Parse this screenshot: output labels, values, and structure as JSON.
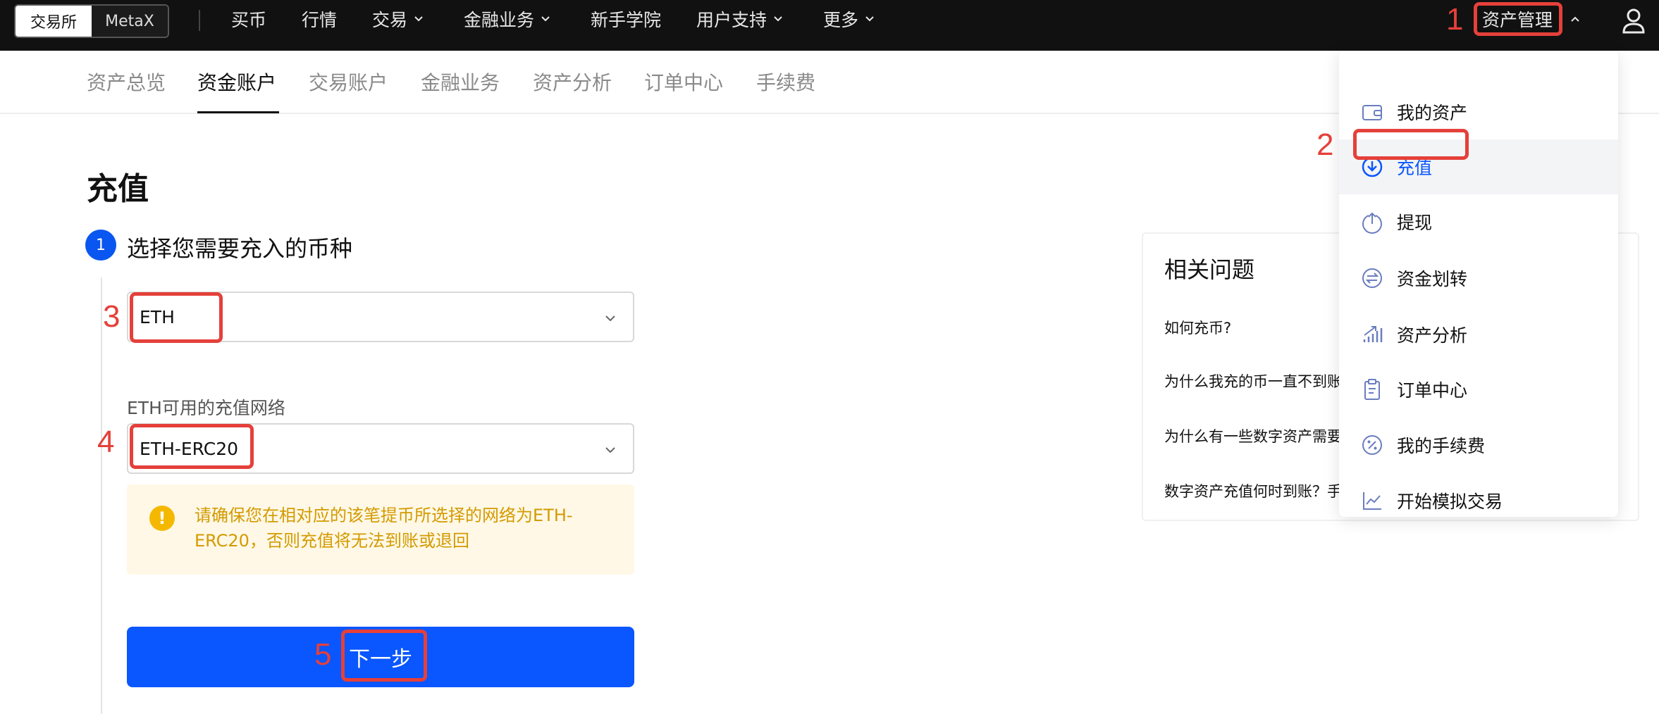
{
  "top_nav": {
    "segments": [
      "交易所",
      "MetaX"
    ],
    "items": [
      {
        "label": "买币",
        "has_chevron": false
      },
      {
        "label": "行情",
        "has_chevron": false
      },
      {
        "label": "交易",
        "has_chevron": true
      },
      {
        "label": "金融业务",
        "has_chevron": true
      },
      {
        "label": "新手学院",
        "has_chevron": false
      },
      {
        "label": "用户支持",
        "has_chevron": true
      },
      {
        "label": "更多",
        "has_chevron": true
      }
    ],
    "asset_management": "资产管理"
  },
  "sub_nav": {
    "items": [
      "资产总览",
      "资金账户",
      "交易账户",
      "金融业务",
      "资产分析",
      "订单中心",
      "手续费"
    ],
    "active": "资金账户"
  },
  "main": {
    "title": "充值",
    "step_number": "1",
    "step_title": "选择您需要充入的币种",
    "coin_value": "ETH",
    "network_label": "ETH可用的充值网络",
    "network_value": "ETH-ERC20",
    "warning_icon_glyph": "!",
    "warning_text": "请确保您在相对应的该笔提币所选择的网络为ETH-ERC20，否则充值将无法到账或退回",
    "next_button": "下一步"
  },
  "faq": {
    "title": "相关问题",
    "items": [
      "如何充币?",
      "为什么我充的币一直不到账",
      "为什么有一些数字资产需要",
      "数字资产充值何时到账？手"
    ]
  },
  "dropdown": {
    "items": [
      {
        "label": "我的资产",
        "icon": "wallet-icon"
      },
      {
        "label": "充值",
        "icon": "deposit-icon"
      },
      {
        "label": "提现",
        "icon": "withdraw-icon"
      },
      {
        "label": "资金划转",
        "icon": "transfer-icon"
      },
      {
        "label": "资产分析",
        "icon": "analysis-icon"
      },
      {
        "label": "订单中心",
        "icon": "clipboard-icon"
      },
      {
        "label": "我的手续费",
        "icon": "fee-icon"
      },
      {
        "label": "开始模拟交易",
        "icon": "chart-line-icon"
      }
    ],
    "active": "充值"
  },
  "annotations": [
    "1",
    "2",
    "3",
    "4",
    "5"
  ],
  "colors": {
    "accent": "#0a56ff",
    "annotation": "#e5403a",
    "warning": "#f5b800"
  }
}
